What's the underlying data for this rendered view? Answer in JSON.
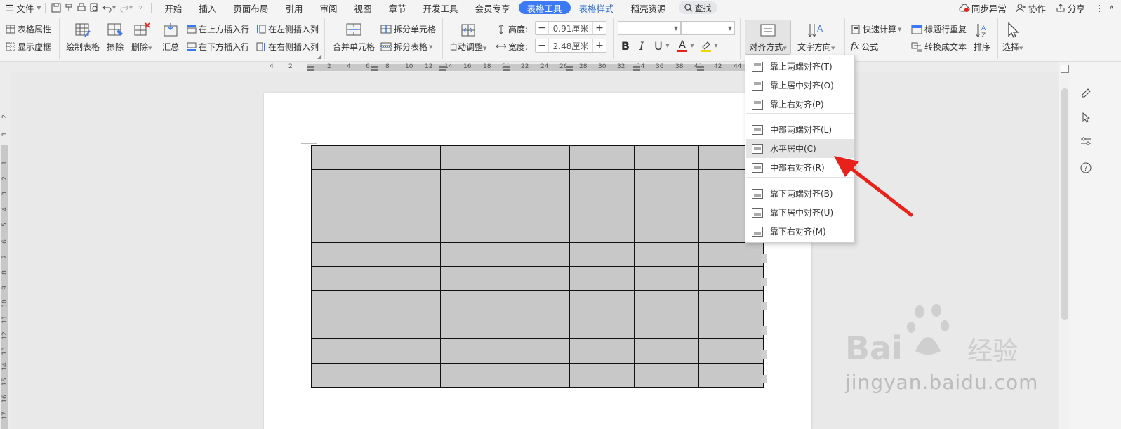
{
  "menubar": {
    "file": "文件",
    "tabs": [
      "开始",
      "插入",
      "页面布局",
      "引用",
      "审阅",
      "视图",
      "章节",
      "开发工具",
      "会员专享",
      "表格工具",
      "表格样式",
      "稻壳资源"
    ],
    "active_tab_index": 9,
    "search": "查找",
    "right": {
      "sync": "同步异常",
      "collab": "协作",
      "share": "分享"
    }
  },
  "ribbon": {
    "table_props": "表格属性",
    "show_grid": "显示虚框",
    "draw_table": "绘制表格",
    "erase": "擦除",
    "delete": "删除",
    "summary": "汇总",
    "insert_above": "在上方插入行",
    "insert_below": "在下方插入行",
    "insert_left": "在左侧插入列",
    "insert_right": "在右侧插入列",
    "merge": "合并单元格",
    "split_cell": "拆分单元格",
    "split_table": "拆分表格",
    "auto_fit": "自动调整",
    "height_label": "高度:",
    "height_value": "0.91厘米",
    "width_label": "宽度:",
    "width_value": "2.48厘米",
    "align": "对齐方式",
    "text_dir": "文字方向",
    "quick_calc": "快速计算",
    "header_repeat": "标题行重复",
    "formula": "公式",
    "to_text": "转换成文本",
    "sort": "排序",
    "select": "选择",
    "bold": "B",
    "italic": "I",
    "underline": "U",
    "font_color_glyph": "A"
  },
  "ruler": {
    "h_numbers": [
      "4",
      "2",
      "2",
      "4",
      "6",
      "8",
      "10",
      "12",
      "14",
      "16",
      "18",
      "20",
      "22",
      "24",
      "26",
      "28",
      "30",
      "32",
      "34",
      "36",
      "38",
      "40",
      "42",
      "44"
    ],
    "v_numbers": [
      "2",
      "1",
      "1",
      "2",
      "3",
      "4",
      "5",
      "6",
      "7",
      "8",
      "9",
      "10",
      "11",
      "12",
      "13",
      "14",
      "15",
      "16",
      "17"
    ]
  },
  "table": {
    "rows": 10,
    "cols": 7
  },
  "dropdown": {
    "items": [
      {
        "label": "靠上两端对齐(T)",
        "v": "top"
      },
      {
        "label": "靠上居中对齐(O)",
        "v": "top"
      },
      {
        "label": "靠上右对齐(P)",
        "v": "top"
      },
      {
        "label": "中部两端对齐(L)",
        "v": "mid"
      },
      {
        "label": "水平居中(C)",
        "v": "mid",
        "hover": true
      },
      {
        "label": "中部右对齐(R)",
        "v": "mid"
      },
      {
        "label": "靠下两端对齐(B)",
        "v": "bot"
      },
      {
        "label": "靠下居中对齐(U)",
        "v": "bot"
      },
      {
        "label": "靠下右对齐(M)",
        "v": "bot"
      }
    ]
  },
  "watermark": {
    "logo": "Bai du 经验",
    "url": "jingyan.baidu.com"
  },
  "colors": {
    "accent": "#3b7af4",
    "arrow": "#e8221b",
    "cell": "#c8c8c8"
  }
}
